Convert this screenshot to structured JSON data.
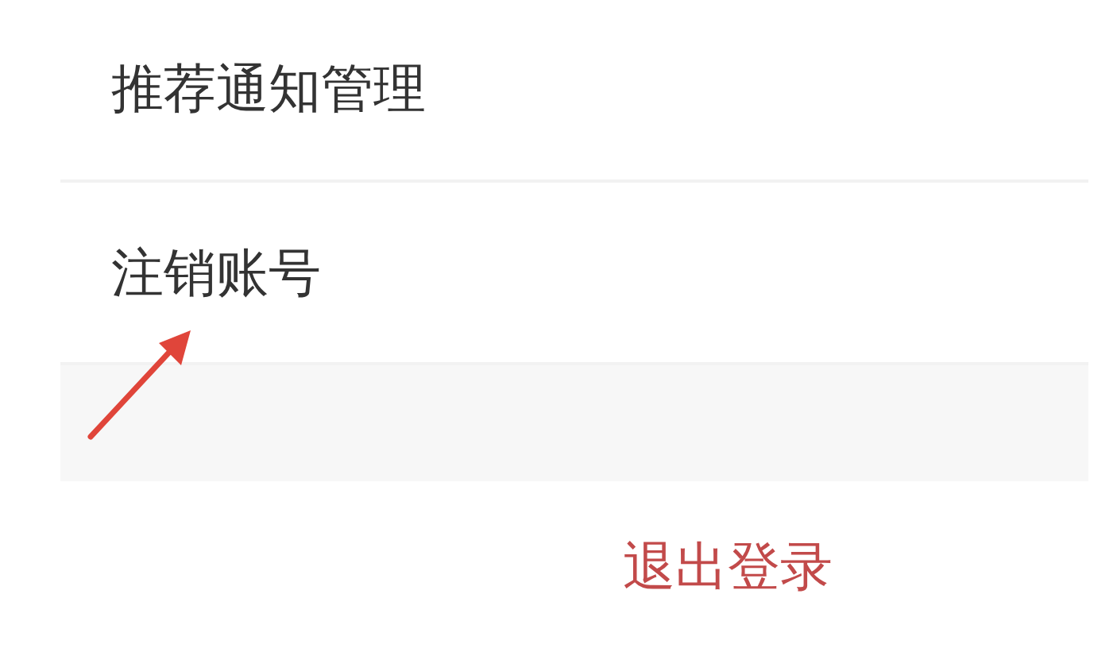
{
  "settings_items": [
    {
      "label": "推荐通知管理"
    },
    {
      "label": "注销账号"
    }
  ],
  "logout": {
    "label": "退出登录"
  }
}
